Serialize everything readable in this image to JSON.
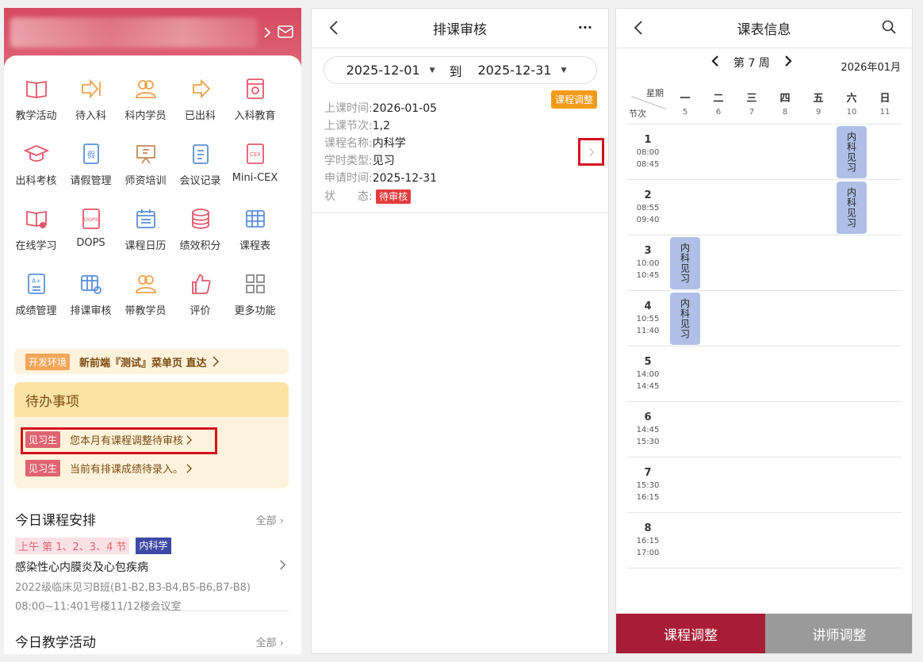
{
  "home": {
    "grid": [
      {
        "label": "教学活动",
        "icon": "book-icon",
        "color": "#e5566b"
      },
      {
        "label": "待入科",
        "icon": "enter-arrow-icon",
        "color": "#f0a04b"
      },
      {
        "label": "科内学员",
        "icon": "users-icon",
        "color": "#f0a04b"
      },
      {
        "label": "已出科",
        "icon": "exit-arrow-icon",
        "color": "#f0a04b"
      },
      {
        "label": "入科教育",
        "icon": "badge-icon",
        "color": "#e5566b"
      },
      {
        "label": "出科考核",
        "icon": "graduation-cap-icon",
        "color": "#e5566b"
      },
      {
        "label": "请假管理",
        "icon": "leave-icon",
        "color": "#5b8fd8"
      },
      {
        "label": "师资培训",
        "icon": "presentation-icon",
        "color": "#c48a5a"
      },
      {
        "label": "会议记录",
        "icon": "clipboard-icon",
        "color": "#5b8fd8"
      },
      {
        "label": "Mini-CEX",
        "icon": "cex-icon",
        "color": "#e5566b"
      },
      {
        "label": "在线学习",
        "icon": "online-book-icon",
        "color": "#e5566b"
      },
      {
        "label": "DOPS",
        "icon": "dops-icon",
        "color": "#e5566b"
      },
      {
        "label": "课程日历",
        "icon": "calendar-icon",
        "color": "#5b8fd8"
      },
      {
        "label": "绩效积分",
        "icon": "coins-icon",
        "color": "#e5566b"
      },
      {
        "label": "课程表",
        "icon": "table-icon",
        "color": "#5b8fd8"
      },
      {
        "label": "成绩管理",
        "icon": "grade-icon",
        "color": "#5b8fd8"
      },
      {
        "label": "排课审核",
        "icon": "schedule-review-icon",
        "color": "#5b8fd8"
      },
      {
        "label": "带教学员",
        "icon": "mentor-icon",
        "color": "#f0a04b"
      },
      {
        "label": "评价",
        "icon": "thumbs-up-icon",
        "color": "#e5566b"
      },
      {
        "label": "更多功能",
        "icon": "more-grid-icon",
        "color": "#888888"
      }
    ],
    "dev": {
      "tag": "开发环境",
      "text": "新前端『测试』菜单页 直达"
    },
    "todo": {
      "title": "待办事项",
      "items": [
        {
          "tag": "见习生",
          "text": "您本月有课程调整待审核"
        },
        {
          "tag": "见习生",
          "text": "当前有排课成绩待录入。"
        }
      ]
    },
    "today_course": {
      "title": "今日课程安排",
      "more": "全部",
      "tag_time": "上午 第 1、2、3、4 节",
      "tag_dept": "内科学",
      "name": "感染性心内膜炎及心包疾病",
      "class": "2022级临床见习B班(B1-B2,B3-B4,B5-B6,B7-B8)",
      "time_place": "08:00~11:401号楼11/12楼会议室"
    },
    "today_activity": {
      "title": "今日教学活动",
      "more": "全部"
    }
  },
  "review": {
    "title": "排课审核",
    "more": "···",
    "start": "2025-12-01",
    "to": "到",
    "end": "2025-12-31",
    "badge": "课程调整",
    "fields": [
      {
        "label": "上课时间:",
        "value": "2026-01-05"
      },
      {
        "label": "上课节次:",
        "value": "1,2"
      },
      {
        "label": "课程名称:",
        "value": "内科学"
      },
      {
        "label": "学时类型:",
        "value": "见习"
      },
      {
        "label": "申请时间:",
        "value": "2025-12-31"
      }
    ],
    "status_label": "状　　态:",
    "status_value": "待审核"
  },
  "schedule": {
    "title": "课表信息",
    "week": "第 7 周",
    "month": "2026年01月",
    "corner_top": "星期",
    "corner_bottom": "节次",
    "days": [
      {
        "n": "一",
        "d": "5"
      },
      {
        "n": "二",
        "d": "6"
      },
      {
        "n": "三",
        "d": "7"
      },
      {
        "n": "四",
        "d": "8"
      },
      {
        "n": "五",
        "d": "9"
      },
      {
        "n": "六",
        "d": "10"
      },
      {
        "n": "日",
        "d": "11"
      }
    ],
    "periods": [
      {
        "n": "1",
        "start": "08:00",
        "end": "08:45"
      },
      {
        "n": "2",
        "start": "08:55",
        "end": "09:40"
      },
      {
        "n": "3",
        "start": "10:00",
        "end": "10:45"
      },
      {
        "n": "4",
        "start": "10:55",
        "end": "11:40"
      },
      {
        "n": "5",
        "start": "14:00",
        "end": "14:45"
      },
      {
        "n": "6",
        "start": "14:45",
        "end": "15:30"
      },
      {
        "n": "7",
        "start": "15:30",
        "end": "16:15"
      },
      {
        "n": "8",
        "start": "16:15",
        "end": "17:00"
      }
    ],
    "events": [
      {
        "period": 1,
        "day": 6,
        "text": "内科见习"
      },
      {
        "period": 2,
        "day": 6,
        "text": "内科见习"
      },
      {
        "period": 3,
        "day": 1,
        "text": "内科见习"
      },
      {
        "period": 4,
        "day": 1,
        "text": "内科见习"
      }
    ],
    "btn_course": "课程调整",
    "btn_teacher": "讲师调整"
  }
}
